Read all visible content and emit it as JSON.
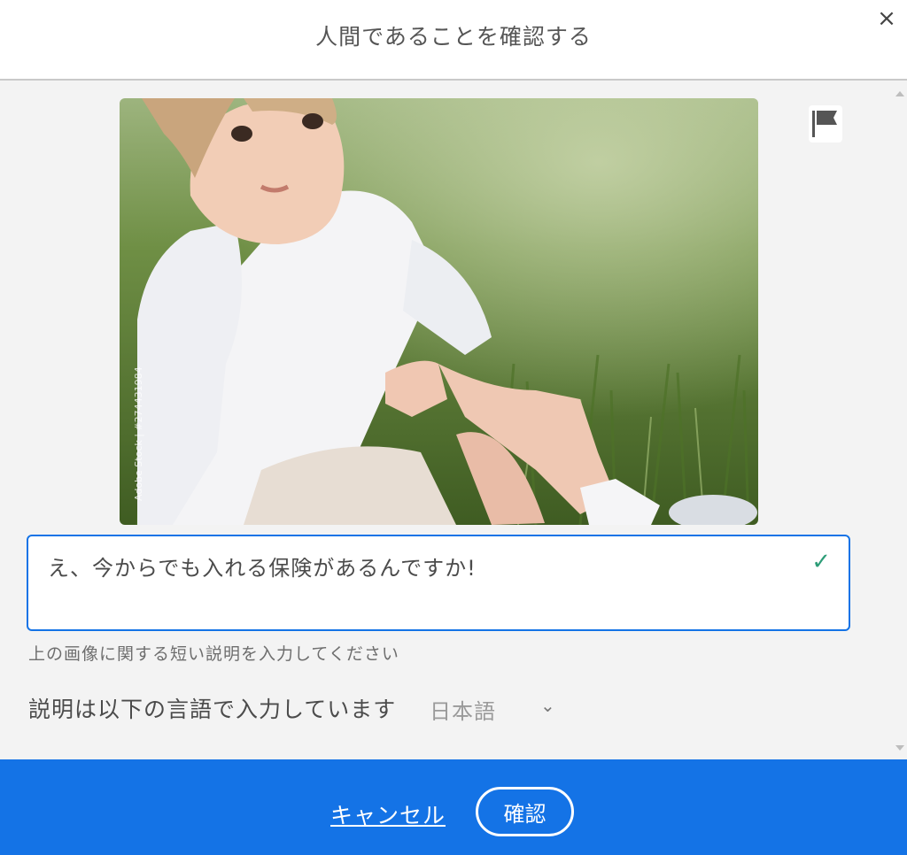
{
  "dialog": {
    "title": "人間であることを確認する",
    "close_glyph": "×"
  },
  "image": {
    "watermark_id": "Adobe Stock | #274431984"
  },
  "caption_input": {
    "value": "え、今からでも入れる保険があるんですか!",
    "check_glyph": "✓"
  },
  "hint_text": "上の画像に関する短い説明を入力してください",
  "language": {
    "label": "説明は以下の言語で入力しています",
    "selected": "日本語",
    "chevron_glyph": "⌄"
  },
  "footer": {
    "cancel_label": "キャンセル",
    "confirm_label": "確認"
  },
  "colors": {
    "accent": "#1473e6",
    "success": "#2d9d78"
  }
}
